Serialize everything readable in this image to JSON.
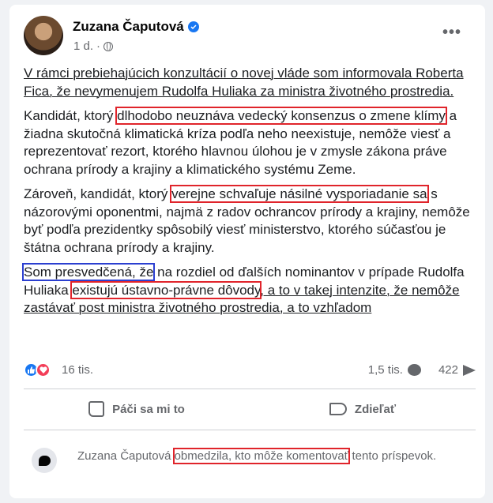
{
  "post": {
    "author": "Zuzana Čaputová",
    "time": "1 d.",
    "separator": "·",
    "more_label": "•••",
    "paragraphs": {
      "p1": "V rámci prebiehajúcich konzultácií o novej vláde som informovala Roberta Fica, že nevymenujem Rudolfa Huliaka za ministra životného prostredia.",
      "p2_a": "Kandidát, ktorý ",
      "p2_hl": "dlhodobo neuznáva vedecký konsenzus o zmene klímy",
      "p2_b": " a žiadna skutočná klimatická kríza podľa neho neexistuje, nemôže viesť a reprezentovať rezort, ktorého hlavnou úlohou je v zmysle zákona práve ochrana prírody a krajiny a klimatického systému Zeme.",
      "p3_a": "Zároveň, kandidát, ktorý ",
      "p3_hl": "verejne schvaľuje násilné vysporiadanie sa",
      "p3_b": " s názorovými oponentmi, najmä z radov ochrancov prírody a krajiny, nemôže byť podľa prezidentky spôsobilý viesť ministerstvo, ktorého súčasťou je štátna ochrana prírody a krajiny.",
      "p4_hl_blue": "Som presvedčená, že",
      "p4_a": " na rozdiel od ďalších nominantov v prípade Rudolfa Huliaka ",
      "p4_hl": "existujú ústavno-právne dôvody",
      "p4_b": ", a to v takej intenzite, že nemôže zastávať post ministra životného prostredia, a to vzhľadom"
    }
  },
  "stats": {
    "reactions": "16 tis.",
    "comments": "1,5 tis.",
    "shares": "422"
  },
  "actions": {
    "like": "Páči sa mi to",
    "share": "Zdieľať"
  },
  "notice": {
    "a": "Zuzana Čaputová ",
    "hl": "obmedzila, kto môže komentovať",
    "b": " tento príspevok."
  },
  "colors": {
    "highlight_red": "#e0242b",
    "highlight_blue": "#2b3fd0",
    "like_blue": "#1877f2",
    "love_red": "#f33e58"
  }
}
